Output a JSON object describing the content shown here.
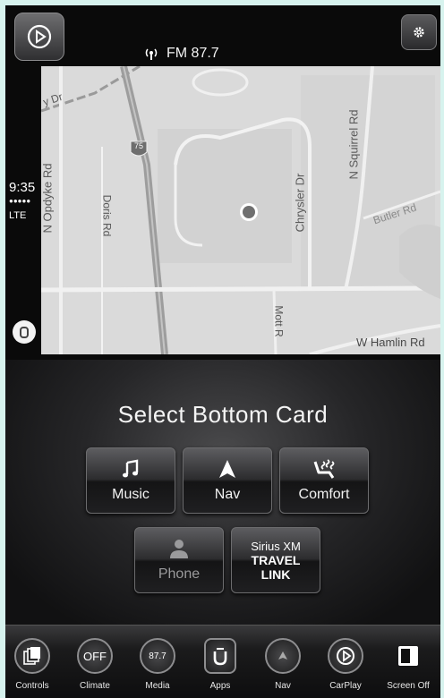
{
  "radio": {
    "icon": "antenna-icon",
    "station": "FM 87.7"
  },
  "status": {
    "time": "9:35",
    "signal": "●●●●●",
    "network": "LTE"
  },
  "map": {
    "labels": {
      "dy_dr": "y Dr",
      "n_opdyke": "N Opdyke Rd",
      "doris": "Doris Rd",
      "chrysler": "Chrysler Dr",
      "squirrel": "N Squirrel Rd",
      "butler": "Butler Rd",
      "mott": "Mott R",
      "w_hamlin": "W Hamlin Rd",
      "interstate": "75"
    }
  },
  "panel": {
    "title": "Select Bottom Card",
    "cards": [
      {
        "label": "Music",
        "icon": "music-note-icon"
      },
      {
        "label": "Nav",
        "icon": "navigation-arrow-icon"
      },
      {
        "label": "Comfort",
        "icon": "seat-comfort-icon"
      },
      {
        "label": "Phone",
        "icon": "person-icon"
      }
    ],
    "siriusxm": {
      "top": "Sirius XM",
      "line1": "TRAVEL",
      "line2": "LINK"
    }
  },
  "controls": {
    "items": [
      {
        "label": "Controls",
        "icon": "controls-icon"
      },
      {
        "label": "Climate",
        "icon": "climate-off-icon",
        "value": "OFF"
      },
      {
        "label": "Media",
        "icon": "media-icon",
        "value": "87.7"
      },
      {
        "label": "Apps",
        "icon": "apps-icon"
      },
      {
        "label": "Nav",
        "icon": "nav-icon"
      },
      {
        "label": "CarPlay",
        "icon": "carplay-icon"
      },
      {
        "label": "Screen Off",
        "icon": "screen-off-icon"
      }
    ]
  }
}
